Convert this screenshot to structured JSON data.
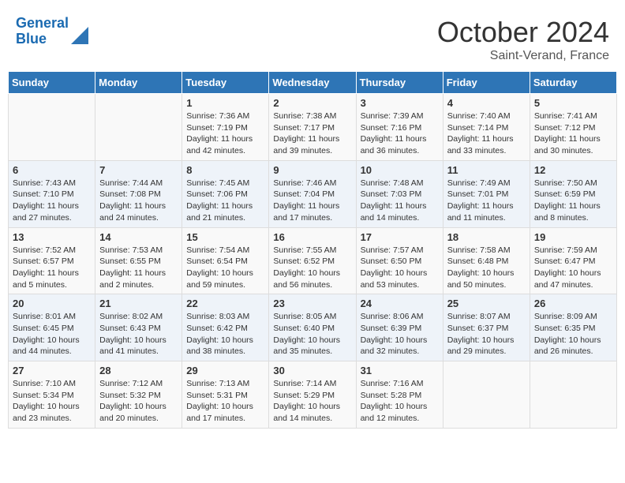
{
  "header": {
    "logo_line1": "General",
    "logo_line2": "Blue",
    "title": "October 2024",
    "subtitle": "Saint-Verand, France"
  },
  "calendar": {
    "days_of_week": [
      "Sunday",
      "Monday",
      "Tuesday",
      "Wednesday",
      "Thursday",
      "Friday",
      "Saturday"
    ],
    "weeks": [
      [
        {
          "day": "",
          "info": ""
        },
        {
          "day": "",
          "info": ""
        },
        {
          "day": "1",
          "info": "Sunrise: 7:36 AM\nSunset: 7:19 PM\nDaylight: 11 hours and 42 minutes."
        },
        {
          "day": "2",
          "info": "Sunrise: 7:38 AM\nSunset: 7:17 PM\nDaylight: 11 hours and 39 minutes."
        },
        {
          "day": "3",
          "info": "Sunrise: 7:39 AM\nSunset: 7:16 PM\nDaylight: 11 hours and 36 minutes."
        },
        {
          "day": "4",
          "info": "Sunrise: 7:40 AM\nSunset: 7:14 PM\nDaylight: 11 hours and 33 minutes."
        },
        {
          "day": "5",
          "info": "Sunrise: 7:41 AM\nSunset: 7:12 PM\nDaylight: 11 hours and 30 minutes."
        }
      ],
      [
        {
          "day": "6",
          "info": "Sunrise: 7:43 AM\nSunset: 7:10 PM\nDaylight: 11 hours and 27 minutes."
        },
        {
          "day": "7",
          "info": "Sunrise: 7:44 AM\nSunset: 7:08 PM\nDaylight: 11 hours and 24 minutes."
        },
        {
          "day": "8",
          "info": "Sunrise: 7:45 AM\nSunset: 7:06 PM\nDaylight: 11 hours and 21 minutes."
        },
        {
          "day": "9",
          "info": "Sunrise: 7:46 AM\nSunset: 7:04 PM\nDaylight: 11 hours and 17 minutes."
        },
        {
          "day": "10",
          "info": "Sunrise: 7:48 AM\nSunset: 7:03 PM\nDaylight: 11 hours and 14 minutes."
        },
        {
          "day": "11",
          "info": "Sunrise: 7:49 AM\nSunset: 7:01 PM\nDaylight: 11 hours and 11 minutes."
        },
        {
          "day": "12",
          "info": "Sunrise: 7:50 AM\nSunset: 6:59 PM\nDaylight: 11 hours and 8 minutes."
        }
      ],
      [
        {
          "day": "13",
          "info": "Sunrise: 7:52 AM\nSunset: 6:57 PM\nDaylight: 11 hours and 5 minutes."
        },
        {
          "day": "14",
          "info": "Sunrise: 7:53 AM\nSunset: 6:55 PM\nDaylight: 11 hours and 2 minutes."
        },
        {
          "day": "15",
          "info": "Sunrise: 7:54 AM\nSunset: 6:54 PM\nDaylight: 10 hours and 59 minutes."
        },
        {
          "day": "16",
          "info": "Sunrise: 7:55 AM\nSunset: 6:52 PM\nDaylight: 10 hours and 56 minutes."
        },
        {
          "day": "17",
          "info": "Sunrise: 7:57 AM\nSunset: 6:50 PM\nDaylight: 10 hours and 53 minutes."
        },
        {
          "day": "18",
          "info": "Sunrise: 7:58 AM\nSunset: 6:48 PM\nDaylight: 10 hours and 50 minutes."
        },
        {
          "day": "19",
          "info": "Sunrise: 7:59 AM\nSunset: 6:47 PM\nDaylight: 10 hours and 47 minutes."
        }
      ],
      [
        {
          "day": "20",
          "info": "Sunrise: 8:01 AM\nSunset: 6:45 PM\nDaylight: 10 hours and 44 minutes."
        },
        {
          "day": "21",
          "info": "Sunrise: 8:02 AM\nSunset: 6:43 PM\nDaylight: 10 hours and 41 minutes."
        },
        {
          "day": "22",
          "info": "Sunrise: 8:03 AM\nSunset: 6:42 PM\nDaylight: 10 hours and 38 minutes."
        },
        {
          "day": "23",
          "info": "Sunrise: 8:05 AM\nSunset: 6:40 PM\nDaylight: 10 hours and 35 minutes."
        },
        {
          "day": "24",
          "info": "Sunrise: 8:06 AM\nSunset: 6:39 PM\nDaylight: 10 hours and 32 minutes."
        },
        {
          "day": "25",
          "info": "Sunrise: 8:07 AM\nSunset: 6:37 PM\nDaylight: 10 hours and 29 minutes."
        },
        {
          "day": "26",
          "info": "Sunrise: 8:09 AM\nSunset: 6:35 PM\nDaylight: 10 hours and 26 minutes."
        }
      ],
      [
        {
          "day": "27",
          "info": "Sunrise: 7:10 AM\nSunset: 5:34 PM\nDaylight: 10 hours and 23 minutes."
        },
        {
          "day": "28",
          "info": "Sunrise: 7:12 AM\nSunset: 5:32 PM\nDaylight: 10 hours and 20 minutes."
        },
        {
          "day": "29",
          "info": "Sunrise: 7:13 AM\nSunset: 5:31 PM\nDaylight: 10 hours and 17 minutes."
        },
        {
          "day": "30",
          "info": "Sunrise: 7:14 AM\nSunset: 5:29 PM\nDaylight: 10 hours and 14 minutes."
        },
        {
          "day": "31",
          "info": "Sunrise: 7:16 AM\nSunset: 5:28 PM\nDaylight: 10 hours and 12 minutes."
        },
        {
          "day": "",
          "info": ""
        },
        {
          "day": "",
          "info": ""
        }
      ]
    ]
  }
}
